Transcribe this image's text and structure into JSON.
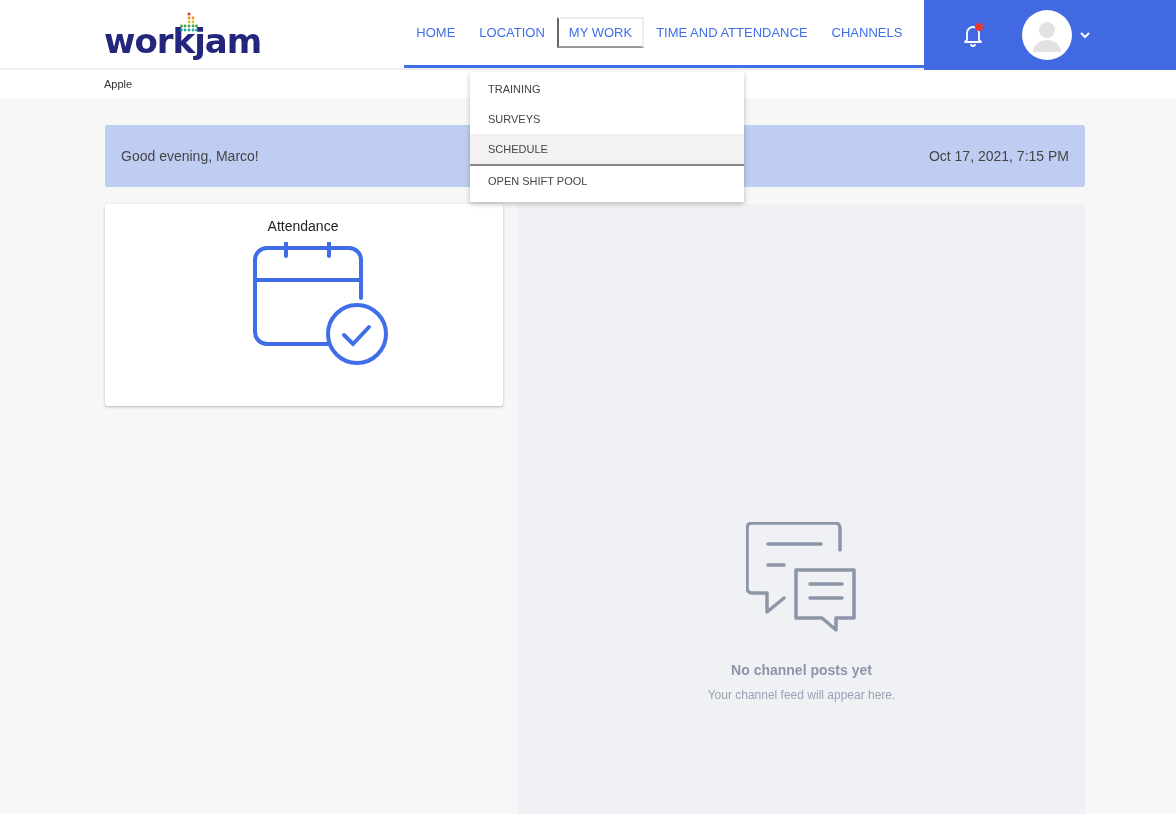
{
  "logo": {
    "text": "workjam"
  },
  "nav": [
    {
      "label": "HOME",
      "selected": false
    },
    {
      "label": "LOCATION",
      "selected": false
    },
    {
      "label": "MY WORK",
      "selected": true
    },
    {
      "label": "TIME AND ATTENDANCE",
      "selected": false
    },
    {
      "label": "CHANNELS",
      "selected": false
    }
  ],
  "notifications": {
    "unread": true
  },
  "breadcrumb": "Apple",
  "dropdown": [
    {
      "label": "TRAINING",
      "selected": false
    },
    {
      "label": "SURVEYS",
      "selected": false
    },
    {
      "label": "SCHEDULE",
      "selected": true
    },
    {
      "label": "OPEN SHIFT POOL",
      "selected": false
    }
  ],
  "greeting": {
    "text": "Good evening, Marco!",
    "datetime": "Oct 17, 2021, 7:15 PM"
  },
  "attendance_card": {
    "title": "Attendance"
  },
  "channels_feed": {
    "title": "No channel posts yet",
    "subtitle": "Your channel feed will appear here."
  }
}
